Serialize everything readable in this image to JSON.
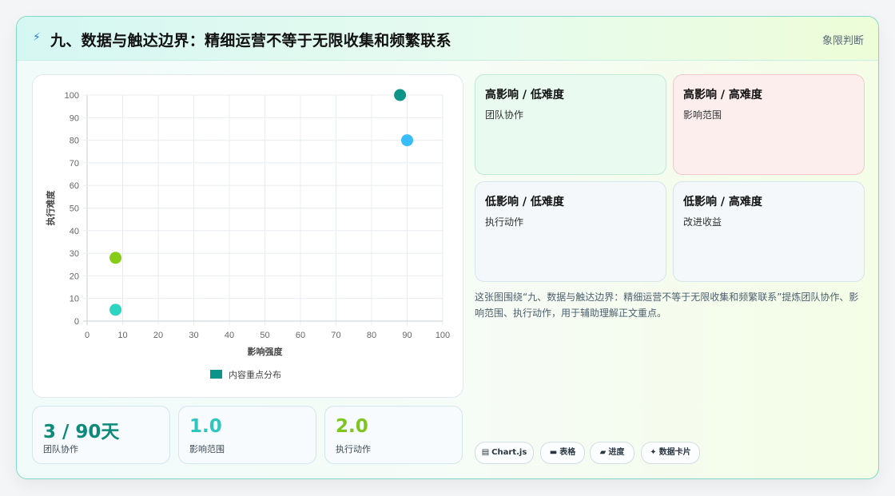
{
  "header": {
    "icon": "lightning-icon",
    "title": "九、数据与触达边界：精细运营不等于无限收集和频繁联系",
    "tag": "象限判断"
  },
  "chart_data": {
    "type": "scatter",
    "xlabel": "影响强度",
    "ylabel": "执行难度",
    "xlim": [
      0,
      100
    ],
    "ylim": [
      0,
      100
    ],
    "xticks": [
      "0",
      "10",
      "20",
      "30",
      "40",
      "50",
      "60",
      "70",
      "80",
      "90",
      "100"
    ],
    "yticks": [
      "0",
      "10",
      "20",
      "30",
      "40",
      "50",
      "60",
      "70",
      "80",
      "90",
      "100"
    ],
    "grid": true,
    "legend": "bottom",
    "series": [
      {
        "name": "内容重点分布",
        "color": "#0d9488",
        "points": [
          {
            "x": 88,
            "y": 100,
            "color": "#0d9488"
          },
          {
            "x": 90,
            "y": 80,
            "color": "#38bdf8"
          },
          {
            "x": 8,
            "y": 28,
            "color": "#84cc16"
          },
          {
            "x": 8,
            "y": 5,
            "color": "#2dd4bf"
          }
        ]
      }
    ]
  },
  "quadrants": [
    {
      "title": "高影响 / 低难度",
      "item": "团队协作"
    },
    {
      "title": "高影响 / 高难度",
      "item": "影响范围"
    },
    {
      "title": "低影响 / 低难度",
      "item": "执行动作"
    },
    {
      "title": "低影响 / 高难度",
      "item": "改进收益"
    }
  ],
  "description": "这张图围绕“九、数据与触达边界：精细运营不等于无限收集和频繁联系”提炼团队协作、影响范围、执行动作，用于辅助理解正文重点。",
  "stats": [
    {
      "value": "3 / 90天",
      "label": "团队协作"
    },
    {
      "value": "1.0",
      "label": "影响范围"
    },
    {
      "value": "2.0",
      "label": "执行动作"
    }
  ],
  "chips": [
    {
      "icon": "chart-icon",
      "label": "Chart.js"
    },
    {
      "icon": "table-icon",
      "label": "表格"
    },
    {
      "icon": "progress-icon",
      "label": "进度"
    },
    {
      "icon": "sparkle-icon",
      "label": "数据卡片"
    }
  ]
}
